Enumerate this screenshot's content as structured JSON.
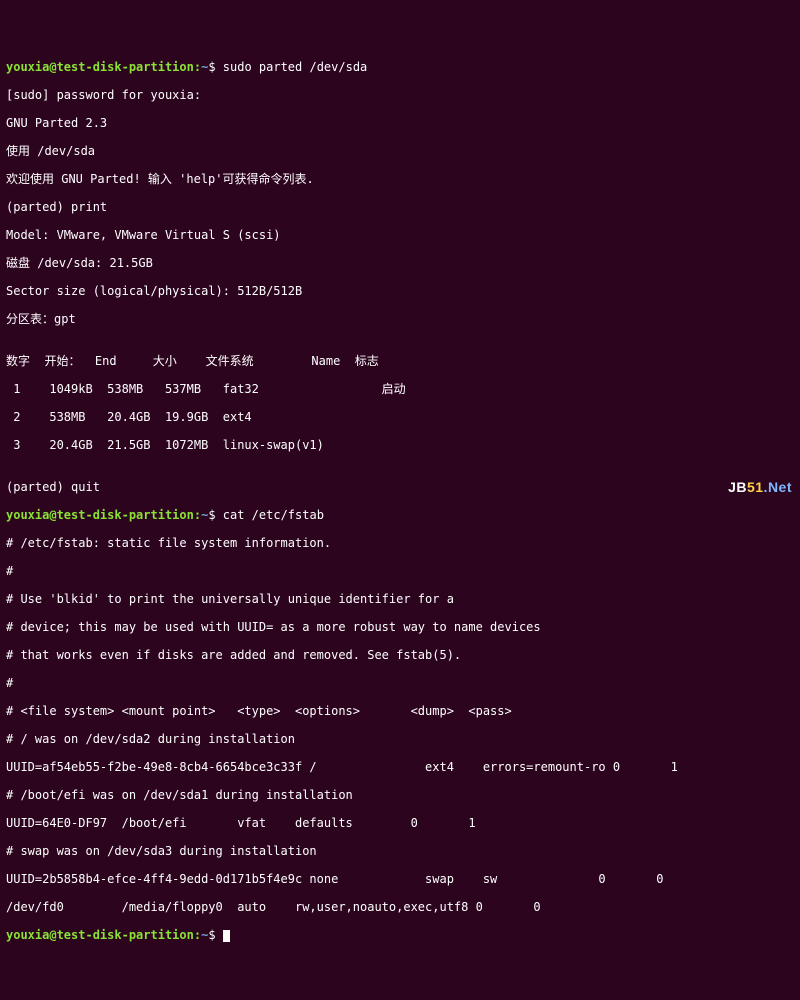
{
  "prompt": {
    "userhost": "youxia@test-disk-partition",
    "sep": ":",
    "path": "~",
    "marker": "$"
  },
  "cmd1": "sudo parted /dev/sda",
  "sudo_line": "[sudo] password for youxia:",
  "parted_banner": "GNU Parted 2.3",
  "parted_using": "使用 /dev/sda",
  "parted_welcome": "欢迎使用 GNU Parted! 输入 'help'可获得命令列表.",
  "parted_prompt1": "(parted) print",
  "model_line": "Model: VMware, VMware Virtual S (scsi)",
  "disk_line": "磁盘 /dev/sda: 21.5GB",
  "sector_line": "Sector size (logical/physical): 512B/512B",
  "table_line": "分区表：gpt",
  "blank1": "",
  "part_header": "数字  开始：  End     大小    文件系统        Name  标志",
  "part_rows": [
    " 1    1049kB  538MB   537MB   fat32                 启动",
    " 2    538MB   20.4GB  19.9GB  ext4",
    " 3    20.4GB  21.5GB  1072MB  linux-swap(v1)"
  ],
  "blank2": "",
  "parted_prompt2": "(parted) quit",
  "cmd2": "cat /etc/fstab",
  "fstab_lines": [
    "# /etc/fstab: static file system information.",
    "#",
    "# Use 'blkid' to print the universally unique identifier for a",
    "# device; this may be used with UUID= as a more robust way to name devices",
    "# that works even if disks are added and removed. See fstab(5).",
    "#",
    "# <file system> <mount point>   <type>  <options>       <dump>  <pass>",
    "# / was on /dev/sda2 during installation",
    "UUID=af54eb55-f2be-49e8-8cb4-6654bce3c33f /               ext4    errors=remount-ro 0       1",
    "# /boot/efi was on /dev/sda1 during installation",
    "UUID=64E0-DF97  /boot/efi       vfat    defaults        0       1",
    "# swap was on /dev/sda3 during installation",
    "UUID=2b5858b4-efce-4ff4-9edd-0d171b5f4e9c none            swap    sw              0       0",
    "/dev/fd0        /media/floppy0  auto    rw,user,noauto,exec,utf8 0       0"
  ],
  "watermark": {
    "jb": "JB",
    "n51": "51",
    "dot": ".",
    "net": "Net"
  },
  "chart_data": {
    "type": "table",
    "title": "GPT partition table (/dev/sda, 21.5GB)",
    "columns": [
      "Number",
      "Start",
      "End",
      "Size",
      "Filesystem",
      "Name",
      "Flags"
    ],
    "rows": [
      {
        "Number": 1,
        "Start": "1049kB",
        "End": "538MB",
        "Size": "537MB",
        "Filesystem": "fat32",
        "Name": "",
        "Flags": "启动"
      },
      {
        "Number": 2,
        "Start": "538MB",
        "End": "20.4GB",
        "Size": "19.9GB",
        "Filesystem": "ext4",
        "Name": "",
        "Flags": ""
      },
      {
        "Number": 3,
        "Start": "20.4GB",
        "End": "21.5GB",
        "Size": "1072MB",
        "Filesystem": "linux-swap(v1)",
        "Name": "",
        "Flags": ""
      }
    ]
  }
}
